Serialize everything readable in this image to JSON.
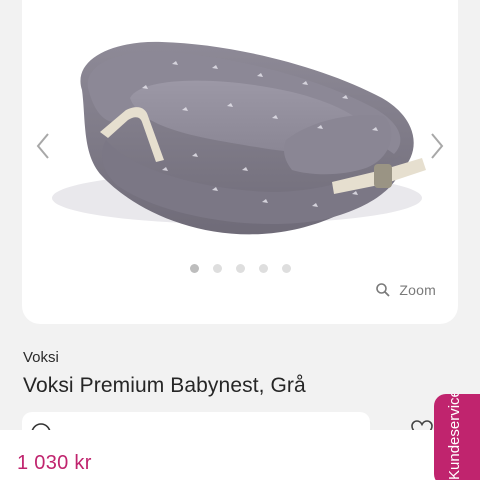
{
  "gallery": {
    "slide_count": 5,
    "active_index": 0,
    "zoom_label": "Zoom"
  },
  "product": {
    "brand": "Voksi",
    "title": "Voksi Premium Babynest, Grå",
    "price": "1 030 kr"
  },
  "customer_service": {
    "label": "Kundeservice"
  },
  "icons": {
    "prev": "chevron-left-icon",
    "next": "chevron-right-icon",
    "zoom": "magnifier-icon",
    "wishlist": "heart-icon"
  },
  "colors": {
    "accent": "#c0246e",
    "background": "#f2f2f2",
    "card": "#ffffff"
  }
}
